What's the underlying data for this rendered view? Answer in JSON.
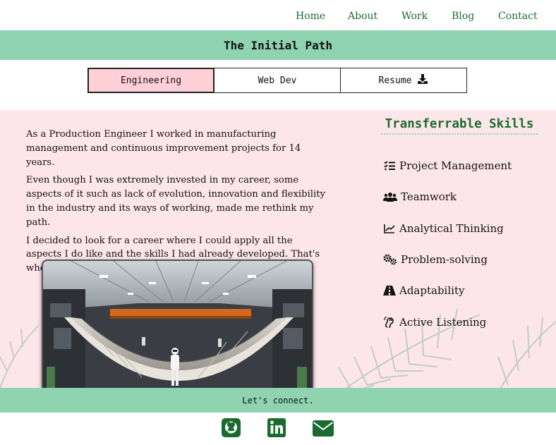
{
  "nav": {
    "items": [
      {
        "label": "Home"
      },
      {
        "label": "About"
      },
      {
        "label": "Work"
      },
      {
        "label": "Blog"
      },
      {
        "label": "Contact"
      }
    ]
  },
  "header": {
    "title": "The Initial Path"
  },
  "tabs": [
    {
      "label": "Engineering",
      "active": true
    },
    {
      "label": "Web Dev",
      "active": false
    },
    {
      "label": "Resume",
      "icon": "download-icon",
      "active": false
    }
  ],
  "story": {
    "paragraphs": [
      "As a Production Engineer I worked in manufacturing management and continuous improvement projects for 14 years.",
      "Even though I was extremely invested in my career, some aspects of it such as lack of evolution, innovation and flexibility in the industry and its ways of working, made me rethink my path.",
      "I decided to look for a career where I could apply all the aspects I do like and the skills I had already developed. That's when, in my long exploration process, I found CODING!"
    ]
  },
  "skills": {
    "title": "Transferrable Skills",
    "items": [
      {
        "label": "Project Management",
        "icon": "task-list-icon"
      },
      {
        "label": "Teamwork",
        "icon": "users-icon"
      },
      {
        "label": "Analytical Thinking",
        "icon": "line-chart-icon"
      },
      {
        "label": "Problem-solving",
        "icon": "gears-icon"
      },
      {
        "label": "Adaptability",
        "icon": "road-icon"
      },
      {
        "label": "Active Listening",
        "icon": "ear-listen-icon"
      }
    ]
  },
  "footer": {
    "connect_label": "Let's connect.",
    "social": [
      {
        "name": "GitHub",
        "icon": "github-icon"
      },
      {
        "name": "LinkedIn",
        "icon": "linkedin-icon"
      },
      {
        "name": "Email",
        "icon": "envelope-icon"
      }
    ]
  },
  "colors": {
    "accent_green": "#90d3b1",
    "link_green": "#1a6b2e",
    "pink_background": "#fde6ea",
    "active_tab": "#ffd0d8"
  }
}
